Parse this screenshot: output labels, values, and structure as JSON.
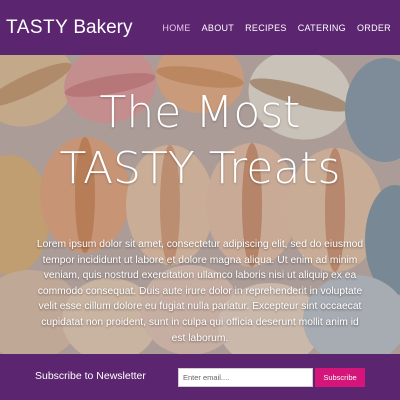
{
  "header": {
    "brand_strong": "TASTY",
    "brand_light": "Bakery",
    "nav": [
      {
        "label": "HOME",
        "active": true
      },
      {
        "label": "ABOUT"
      },
      {
        "label": "RECIPES"
      },
      {
        "label": "CATERING"
      },
      {
        "label": "ORDER"
      }
    ]
  },
  "hero": {
    "title_line1": "The Most",
    "title_line2": "TASTY Treats",
    "paragraph": "Lorem ipsum dolor sit amet, consectetur adipiscing elit, sed do eiusmod tempor incididunt ut labore et dolore magna aliqua. Ut enim ad minim veniam, quis nostrud exercitation ullamco laboris nisi ut aliquip ex ea commodo consequat. Duis aute irure dolor in reprehenderit in voluptate velit esse cillum dolore eu fugiat nulla pariatur. Excepteur sint occaecat cupidatat non proident, sunt in culpa qui officia deserunt mollit anim id est laborum.",
    "background_image": "macarons-photo"
  },
  "newsletter": {
    "label": "Subscribe to Newsletter",
    "email_placeholder": "Enter email....",
    "email_value": "",
    "button_label": "Subscribe"
  },
  "colors": {
    "brand_purple": "#5b2570",
    "accent_pink": "#d6157a",
    "nav_active": "#e8c7ea"
  }
}
